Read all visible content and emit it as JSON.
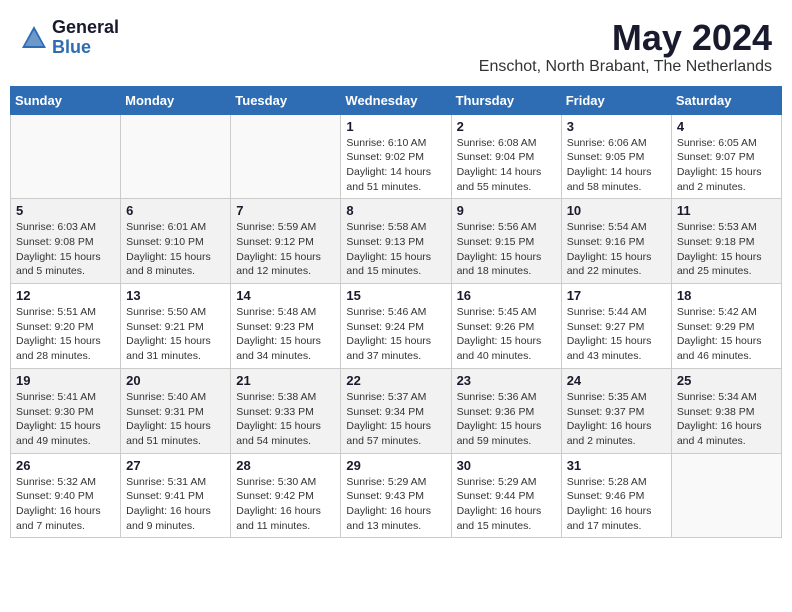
{
  "header": {
    "logo_general": "General",
    "logo_blue": "Blue",
    "month_year": "May 2024",
    "location": "Enschot, North Brabant, The Netherlands"
  },
  "weekdays": [
    "Sunday",
    "Monday",
    "Tuesday",
    "Wednesday",
    "Thursday",
    "Friday",
    "Saturday"
  ],
  "weeks": [
    [
      {
        "day": "",
        "info": ""
      },
      {
        "day": "",
        "info": ""
      },
      {
        "day": "",
        "info": ""
      },
      {
        "day": "1",
        "info": "Sunrise: 6:10 AM\nSunset: 9:02 PM\nDaylight: 14 hours\nand 51 minutes."
      },
      {
        "day": "2",
        "info": "Sunrise: 6:08 AM\nSunset: 9:04 PM\nDaylight: 14 hours\nand 55 minutes."
      },
      {
        "day": "3",
        "info": "Sunrise: 6:06 AM\nSunset: 9:05 PM\nDaylight: 14 hours\nand 58 minutes."
      },
      {
        "day": "4",
        "info": "Sunrise: 6:05 AM\nSunset: 9:07 PM\nDaylight: 15 hours\nand 2 minutes."
      }
    ],
    [
      {
        "day": "5",
        "info": "Sunrise: 6:03 AM\nSunset: 9:08 PM\nDaylight: 15 hours\nand 5 minutes."
      },
      {
        "day": "6",
        "info": "Sunrise: 6:01 AM\nSunset: 9:10 PM\nDaylight: 15 hours\nand 8 minutes."
      },
      {
        "day": "7",
        "info": "Sunrise: 5:59 AM\nSunset: 9:12 PM\nDaylight: 15 hours\nand 12 minutes."
      },
      {
        "day": "8",
        "info": "Sunrise: 5:58 AM\nSunset: 9:13 PM\nDaylight: 15 hours\nand 15 minutes."
      },
      {
        "day": "9",
        "info": "Sunrise: 5:56 AM\nSunset: 9:15 PM\nDaylight: 15 hours\nand 18 minutes."
      },
      {
        "day": "10",
        "info": "Sunrise: 5:54 AM\nSunset: 9:16 PM\nDaylight: 15 hours\nand 22 minutes."
      },
      {
        "day": "11",
        "info": "Sunrise: 5:53 AM\nSunset: 9:18 PM\nDaylight: 15 hours\nand 25 minutes."
      }
    ],
    [
      {
        "day": "12",
        "info": "Sunrise: 5:51 AM\nSunset: 9:20 PM\nDaylight: 15 hours\nand 28 minutes."
      },
      {
        "day": "13",
        "info": "Sunrise: 5:50 AM\nSunset: 9:21 PM\nDaylight: 15 hours\nand 31 minutes."
      },
      {
        "day": "14",
        "info": "Sunrise: 5:48 AM\nSunset: 9:23 PM\nDaylight: 15 hours\nand 34 minutes."
      },
      {
        "day": "15",
        "info": "Sunrise: 5:46 AM\nSunset: 9:24 PM\nDaylight: 15 hours\nand 37 minutes."
      },
      {
        "day": "16",
        "info": "Sunrise: 5:45 AM\nSunset: 9:26 PM\nDaylight: 15 hours\nand 40 minutes."
      },
      {
        "day": "17",
        "info": "Sunrise: 5:44 AM\nSunset: 9:27 PM\nDaylight: 15 hours\nand 43 minutes."
      },
      {
        "day": "18",
        "info": "Sunrise: 5:42 AM\nSunset: 9:29 PM\nDaylight: 15 hours\nand 46 minutes."
      }
    ],
    [
      {
        "day": "19",
        "info": "Sunrise: 5:41 AM\nSunset: 9:30 PM\nDaylight: 15 hours\nand 49 minutes."
      },
      {
        "day": "20",
        "info": "Sunrise: 5:40 AM\nSunset: 9:31 PM\nDaylight: 15 hours\nand 51 minutes."
      },
      {
        "day": "21",
        "info": "Sunrise: 5:38 AM\nSunset: 9:33 PM\nDaylight: 15 hours\nand 54 minutes."
      },
      {
        "day": "22",
        "info": "Sunrise: 5:37 AM\nSunset: 9:34 PM\nDaylight: 15 hours\nand 57 minutes."
      },
      {
        "day": "23",
        "info": "Sunrise: 5:36 AM\nSunset: 9:36 PM\nDaylight: 15 hours\nand 59 minutes."
      },
      {
        "day": "24",
        "info": "Sunrise: 5:35 AM\nSunset: 9:37 PM\nDaylight: 16 hours\nand 2 minutes."
      },
      {
        "day": "25",
        "info": "Sunrise: 5:34 AM\nSunset: 9:38 PM\nDaylight: 16 hours\nand 4 minutes."
      }
    ],
    [
      {
        "day": "26",
        "info": "Sunrise: 5:32 AM\nSunset: 9:40 PM\nDaylight: 16 hours\nand 7 minutes."
      },
      {
        "day": "27",
        "info": "Sunrise: 5:31 AM\nSunset: 9:41 PM\nDaylight: 16 hours\nand 9 minutes."
      },
      {
        "day": "28",
        "info": "Sunrise: 5:30 AM\nSunset: 9:42 PM\nDaylight: 16 hours\nand 11 minutes."
      },
      {
        "day": "29",
        "info": "Sunrise: 5:29 AM\nSunset: 9:43 PM\nDaylight: 16 hours\nand 13 minutes."
      },
      {
        "day": "30",
        "info": "Sunrise: 5:29 AM\nSunset: 9:44 PM\nDaylight: 16 hours\nand 15 minutes."
      },
      {
        "day": "31",
        "info": "Sunrise: 5:28 AM\nSunset: 9:46 PM\nDaylight: 16 hours\nand 17 minutes."
      },
      {
        "day": "",
        "info": ""
      }
    ]
  ]
}
